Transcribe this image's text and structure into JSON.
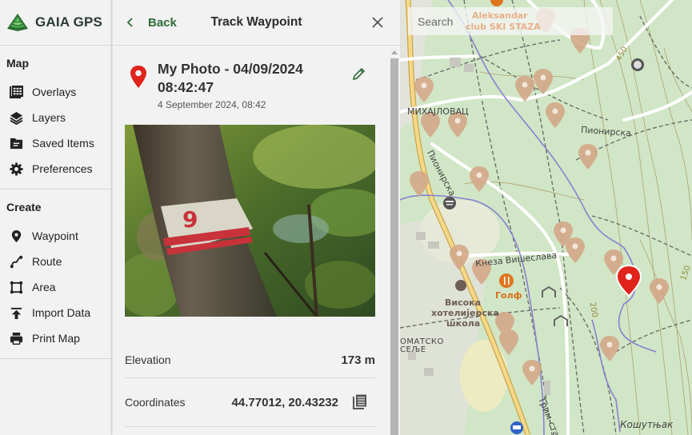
{
  "app": {
    "brand_name": "GAIA GPS",
    "brand_color": "#3a8a3e"
  },
  "sidebar": {
    "sections": [
      {
        "title": "Map",
        "items": [
          {
            "label": "Overlays",
            "icon": "grid-icon"
          },
          {
            "label": "Layers",
            "icon": "layers-icon"
          },
          {
            "label": "Saved Items",
            "icon": "folder-icon"
          },
          {
            "label": "Preferences",
            "icon": "gear-icon"
          }
        ]
      },
      {
        "title": "Create",
        "items": [
          {
            "label": "Waypoint",
            "icon": "pin-icon"
          },
          {
            "label": "Route",
            "icon": "route-icon"
          },
          {
            "label": "Area",
            "icon": "area-icon"
          },
          {
            "label": "Import Data",
            "icon": "upload-icon"
          },
          {
            "label": "Print Map",
            "icon": "printer-icon"
          }
        ]
      }
    ]
  },
  "panel": {
    "back_label": "Back",
    "title": "Track Waypoint",
    "accent_color": "#2e6b38",
    "waypoint": {
      "name": "My Photo - 04/09/2024 08:42:47",
      "date": "4 September 2024, 08:42",
      "pin_color": "#e0241b"
    },
    "details": [
      {
        "label": "Elevation",
        "value": "173 m"
      },
      {
        "label": "Coordinates",
        "value": "44.77012, 20.43232"
      }
    ]
  },
  "map": {
    "search_placeholder": "Search",
    "labels": {
      "aleksandar": "Aleksandar",
      "ski": "club SKI STAZA",
      "mihajlovac": "МИХАЈЛОВАЦ",
      "pionirska1": "Пионирска",
      "pionirska2": "Пионирска",
      "kneza": "Кнеза Вишеслава",
      "golf": "Голф",
      "visoka1": "Висока",
      "visoka2": "хотелијерска",
      "visoka3": "школа",
      "diplomatsko1": "ОМАТСКО",
      "diplomatsko2": "СЕЉЕ",
      "trim": "Трим-ста",
      "kosutnjak": "Кошутњак",
      "c450": "450",
      "c200": "200",
      "c150": "150"
    }
  }
}
